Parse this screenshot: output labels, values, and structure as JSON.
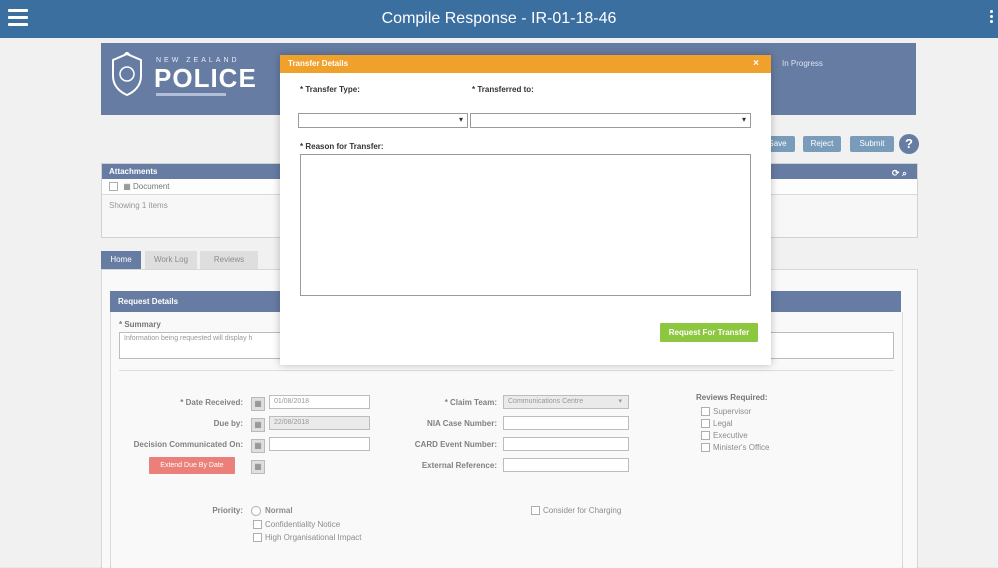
{
  "app": {
    "title": "Compile Response - IR-01-18-46",
    "title_sub": ""
  },
  "banner": {
    "logo_top": "NEW ZEALAND",
    "logo_main": "POLICE",
    "status": "In Progress"
  },
  "actions": [
    {
      "label": "Save"
    },
    {
      "label": "Reject"
    },
    {
      "label": "Submit"
    }
  ],
  "attachments": {
    "title": "Attachments",
    "column": "Document",
    "note": "Showing 1 items"
  },
  "tabs": [
    "Home",
    "Work Log",
    "Reviews"
  ],
  "request": {
    "header": "Request Details",
    "summary_label": "* Summary",
    "summary_value": "Information being requested will display h",
    "fields": {
      "date_received_label": "* Date Received:",
      "date_received_value": "01/08/2018",
      "due_by_label": "Due by:",
      "due_by_value": "22/08/2018",
      "decision_label": "Decision Communicated On:",
      "decision_value": "",
      "extend_button": "Extend Due By Date",
      "claim_team_label": "* Claim Team:",
      "claim_team_value": "Communications Centre",
      "nia_label": "NIA Case Number:",
      "cars_label": "CARD Event Number:",
      "external_label": "External Reference:",
      "reviews_label": "Reviews Required:",
      "reviews": [
        "Supervisor",
        "Legal",
        "Executive",
        "Minister's Office"
      ],
      "priority_label": "Priority:",
      "priority_value": "Normal",
      "priority_options": [
        "Confidentiality Notice",
        "High Organisational Impact"
      ],
      "consider_label": "Consider for Charging"
    }
  },
  "modal": {
    "title": "Transfer Details",
    "close": "×",
    "transfer_type_label": "* Transfer Type:",
    "transferred_to_label": "* Transferred to:",
    "reason_label": "* Reason for Transfer:",
    "submit": "Request For Transfer"
  },
  "colors": {
    "topbar": "#3b6fa0",
    "banner": "#1f3f78",
    "modal_head": "#f0a12c",
    "submit": "#8dc63f",
    "extend": "#e0453a"
  }
}
